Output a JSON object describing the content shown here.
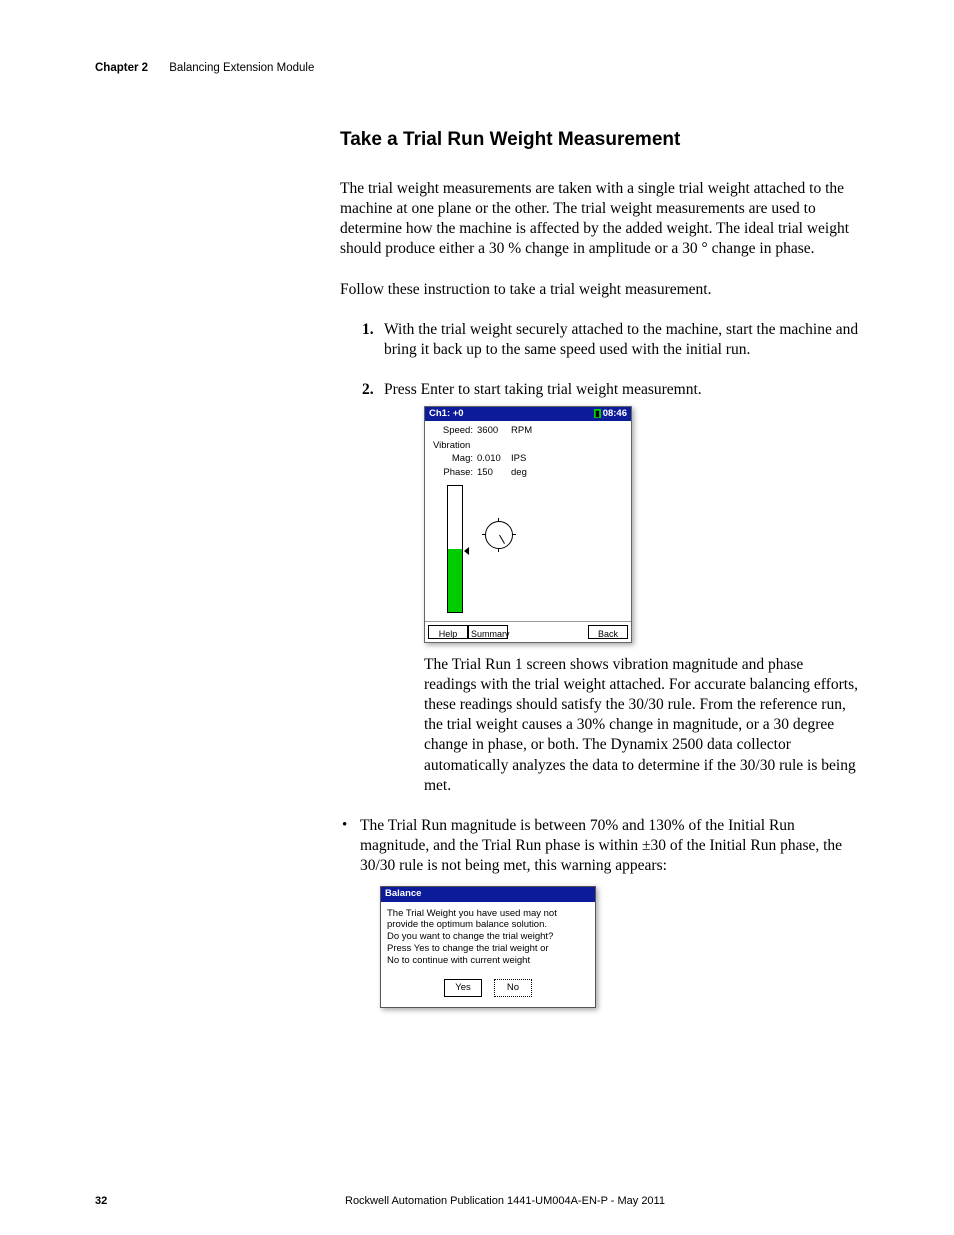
{
  "header": {
    "chapter": "Chapter 2",
    "title": "Balancing Extension Module"
  },
  "section": {
    "heading": "Take a Trial Run Weight Measurement",
    "intro": "The trial weight measurements are taken with a single trial weight attached to the machine at one plane or the other. The trial weight measurements are used to determine how the machine is affected by the added weight. The ideal trial weight should produce either a 30 % change in amplitude or a 30 ° change in phase.",
    "follow": "Follow these instruction to take a trial weight measurement.",
    "steps": [
      "With the trial weight securely attached to the machine, start the machine and bring it back up to the same speed used with the initial run.",
      "Press Enter to start taking trial weight measuremnt."
    ]
  },
  "screen1": {
    "title_left": "Ch1: +0",
    "title_time": "08:46",
    "speed_lbl": "Speed:",
    "speed_val": "3600",
    "speed_unit": "RPM",
    "vibration_lbl": "Vibration",
    "mag_lbl": "Mag:",
    "mag_val": "0.010",
    "mag_unit": "IPS",
    "phase_lbl": "Phase:",
    "phase_val": "150",
    "phase_unit": "deg",
    "btn_help": "Help",
    "btn_summary": "Summary",
    "btn_back": "Back"
  },
  "desc1": "The Trial Run 1 screen shows vibration magnitude and phase readings with the trial weight attached. For accurate balancing efforts, these readings should satisfy the 30/30 rule. From the reference run, the trial weight causes a 30% change in magnitude, or a 30 degree change in phase, or both. The Dynamix 2500 data collector automatically analyzes the data to determine if the 30/30 rule is being met.",
  "bullet": "The Trial Run magnitude is between 70% and 130% of the Initial Run magnitude, and the Trial Run phase is within ±30 of the Initial Run phase, the 30/30 rule is not being met, this warning appears:",
  "screen2": {
    "title": "Balance",
    "line1": "The Trial Weight you have used may not",
    "line2": "provide the optimum balance solution.",
    "line3": "Do you want to change the trial weight?",
    "line4": "Press Yes to change the trial weight or",
    "line5": "No to continue with current weight",
    "btn_yes": "Yes",
    "btn_no": "No"
  },
  "footer": {
    "page": "32",
    "pub": "Rockwell Automation Publication 1441-UM004A-EN-P - May 2011"
  }
}
